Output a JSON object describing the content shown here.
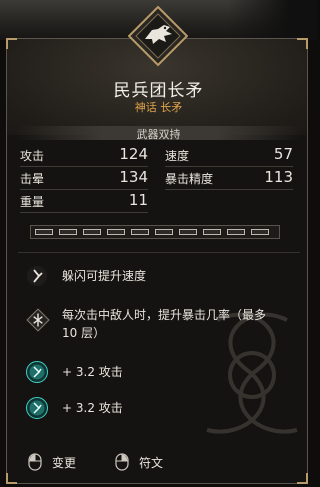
{
  "item": {
    "name": "民兵团长矛",
    "rarity_type": "神话 长矛",
    "category": "武器双持"
  },
  "stats": {
    "attack": {
      "label": "攻击",
      "value": "124"
    },
    "stun": {
      "label": "击晕",
      "value": "134"
    },
    "weight": {
      "label": "重量",
      "value": "11"
    },
    "speed": {
      "label": "速度",
      "value": "57"
    },
    "crit": {
      "label": "暴击精度",
      "value": "113"
    }
  },
  "upgrade_slots": {
    "count": 10
  },
  "perks": [
    {
      "icon": "dodge-rune-icon",
      "text": "躲闪可提升速度"
    },
    {
      "icon": "crit-rune-icon",
      "text_line1": "每次击中敌人时，提升暴击几率（最多",
      "text_line2": "10 层）"
    },
    {
      "icon": "teal-rune-icon",
      "text": "+ 3.2 攻击"
    },
    {
      "icon": "teal-rune-icon",
      "text": "+ 3.2 攻击"
    }
  ],
  "footer": {
    "change_label": "变更",
    "rune_label": "符文"
  },
  "colors": {
    "accent_gold": "#e0a24a",
    "teal": "#3fd0c5",
    "frame": "#b89b6a"
  }
}
